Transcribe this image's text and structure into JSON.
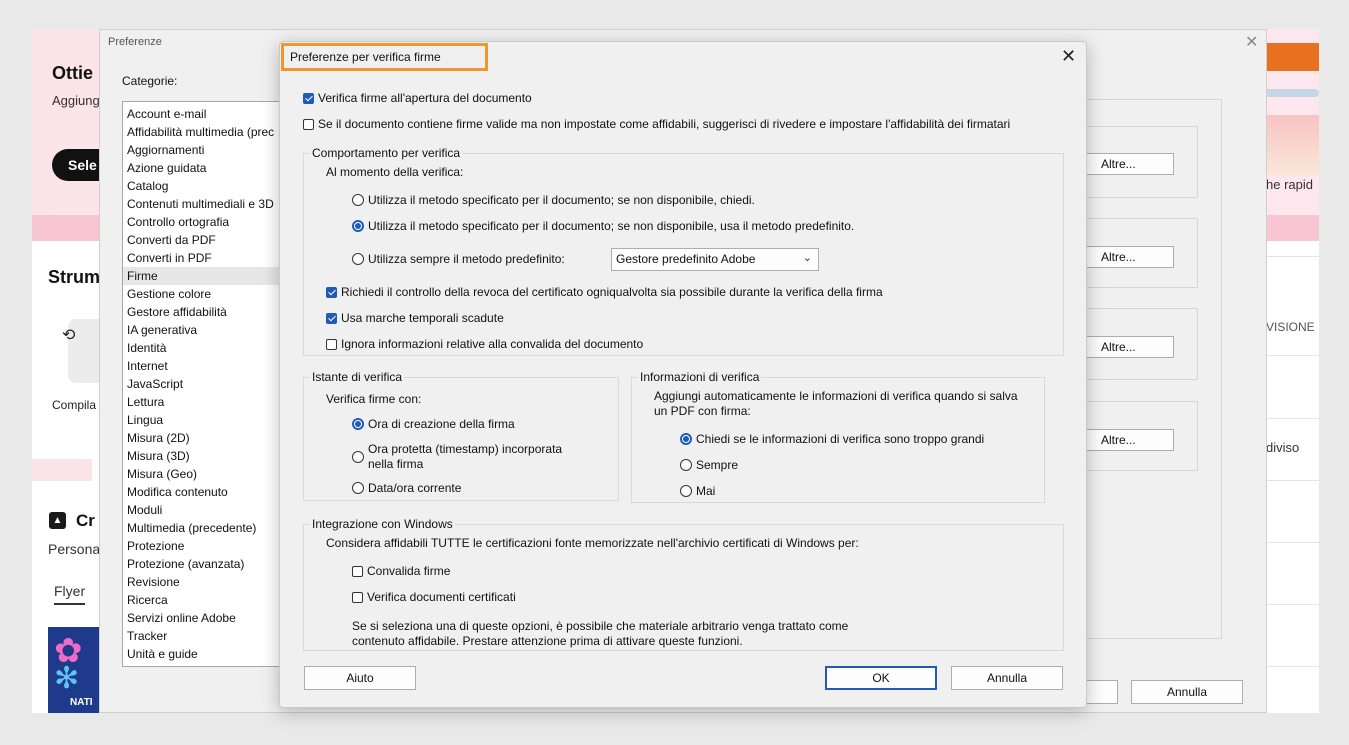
{
  "background_app": {
    "headline": "Ottie",
    "subtitle": "Aggiung",
    "select_button": "Sele",
    "tools_heading": "Strum",
    "tool_label": "Compila",
    "create_heading": "Cr",
    "personalize": "Persona",
    "flyer_tab": "Flyer",
    "thumb_text": "NATI",
    "right_rapid": "he rapid",
    "right_visione": "VISIONE",
    "right_diviso": "diviso"
  },
  "preferences": {
    "title": "Preferenze",
    "categories_label": "Categorie:",
    "categories": [
      "Account e-mail",
      "Affidabilità multimedia (prec",
      "Aggiornamenti",
      "Azione guidata",
      "Catalog",
      "Contenuti multimediali e 3D",
      "Controllo ortografia",
      "Converti da PDF",
      "Converti in PDF",
      "Firme",
      "Gestione colore",
      "Gestore affidabilità",
      "IA generativa",
      "Identità",
      "Internet",
      "JavaScript",
      "Lettura",
      "Lingua",
      "Misura (2D)",
      "Misura (3D)",
      "Misura (Geo)",
      "Modifica contenuto",
      "Moduli",
      "Multimedia (precedente)",
      "Protezione",
      "Protezione (avanzata)",
      "Revisione",
      "Ricerca",
      "Servizi online Adobe",
      "Tracker",
      "Unità e guide"
    ],
    "selected_category": "Firme",
    "altre_button": "Altre...",
    "annulla_button": "Annulla"
  },
  "dialog": {
    "title": "Preferenze per verifica firme",
    "verify_on_open": "Verifica firme all'apertura del documento",
    "suggest_trust": "Se il documento contiene firme valide ma non impostate come affidabili, suggerisci di rivedere e impostare l'affidabilità dei firmatari",
    "behavior": {
      "title": "Comportamento per verifica",
      "when_verifying": "Al momento della verifica:",
      "opt_ask": "Utilizza il metodo specificato per il documento; se non disponibile, chiedi.",
      "opt_default": "Utilizza il metodo specificato per il documento; se non disponibile, usa il metodo predefinito.",
      "opt_always": "Utilizza sempre il metodo predefinito:",
      "default_method": "Gestore predefinito Adobe",
      "revocation_check": "Richiedi il controllo della revoca del certificato ogniqualvolta sia possibile durante la verifica della firma",
      "expired_timestamps": "Usa marche temporali scadute",
      "ignore_validation": "Ignora informazioni relative alla convalida del documento"
    },
    "verification_time": {
      "title": "Istante di verifica",
      "label": "Verifica firme con:",
      "opt_creation": "Ora di creazione della firma",
      "opt_timestamp": "Ora protetta (timestamp) incorporata nella firma",
      "opt_current": "Data/ora corrente"
    },
    "verification_info": {
      "title": "Informazioni di verifica",
      "label": "Aggiungi automaticamente le informazioni di verifica quando si salva un PDF con firma:",
      "opt_ask": "Chiedi se le informazioni di verifica sono troppo grandi",
      "opt_always": "Sempre",
      "opt_never": "Mai"
    },
    "windows": {
      "title": "Integrazione con Windows",
      "label": "Considera affidabili TUTTE le certificazioni fonte memorizzate nell'archivio certificati di Windows per:",
      "validate_signatures": "Convalida firme",
      "verify_certified": "Verifica documenti certificati",
      "warning": "Se si seleziona una di queste opzioni, è possibile che materiale arbitrario venga trattato come contenuto affidabile. Prestare attenzione prima di attivare queste funzioni."
    },
    "help_button": "Aiuto",
    "ok_button": "OK",
    "cancel_button": "Annulla"
  },
  "colors": {
    "accent": "#1f5bb8",
    "highlight_border": "#f0962e"
  }
}
